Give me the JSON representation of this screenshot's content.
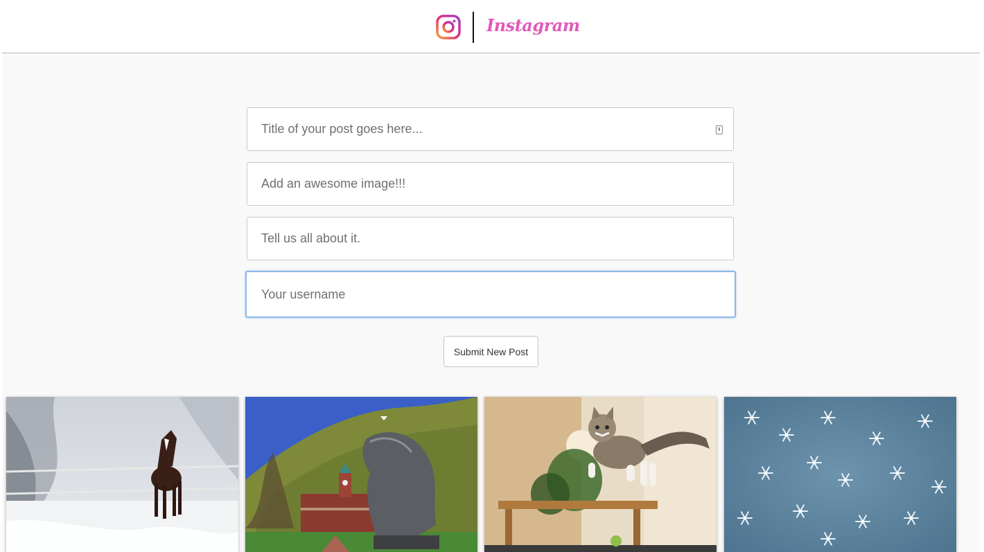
{
  "header": {
    "logo_icon": "instagram-camera-icon",
    "brand_name": "Instagram",
    "brand_color": "#e05ab8"
  },
  "form": {
    "title_placeholder": "Title of your post goes here...",
    "image_placeholder": "Add an awesome image!!!",
    "description_placeholder": "Tell us all about it.",
    "username_placeholder": "Your username",
    "submit_label": "Submit New Post",
    "focus_color": "#8ab8ea"
  },
  "posts": [
    {
      "subject": "horse-in-snow-image"
    },
    {
      "subject": "grizzly-statue-campus-image"
    },
    {
      "subject": "jumping-kitten-image"
    },
    {
      "subject": "snowflakes-image"
    }
  ]
}
